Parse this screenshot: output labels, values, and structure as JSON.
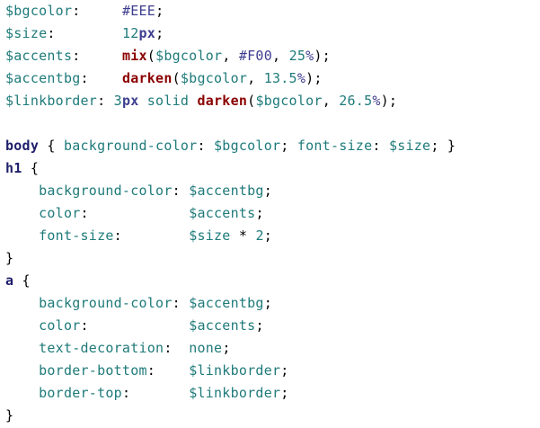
{
  "lines": [
    [
      {
        "t": "$bgcolor",
        "c": "var"
      },
      {
        "t": ":     ",
        "c": "punc"
      },
      {
        "t": "#EEE",
        "c": "hex"
      },
      {
        "t": ";",
        "c": "punc"
      }
    ],
    [
      {
        "t": "$size",
        "c": "var"
      },
      {
        "t": ":        ",
        "c": "punc"
      },
      {
        "t": "12",
        "c": "num"
      },
      {
        "t": "px",
        "c": "unit"
      },
      {
        "t": ";",
        "c": "punc"
      }
    ],
    [
      {
        "t": "$accents",
        "c": "var"
      },
      {
        "t": ":     ",
        "c": "punc"
      },
      {
        "t": "mix",
        "c": "fn"
      },
      {
        "t": "(",
        "c": "punc"
      },
      {
        "t": "$bgcolor",
        "c": "var"
      },
      {
        "t": ", ",
        "c": "punc"
      },
      {
        "t": "#F00",
        "c": "hex"
      },
      {
        "t": ", ",
        "c": "punc"
      },
      {
        "t": "25",
        "c": "num"
      },
      {
        "t": "%",
        "c": "pct"
      },
      {
        "t": ");",
        "c": "punc"
      }
    ],
    [
      {
        "t": "$accentbg",
        "c": "var"
      },
      {
        "t": ":    ",
        "c": "punc"
      },
      {
        "t": "darken",
        "c": "fn"
      },
      {
        "t": "(",
        "c": "punc"
      },
      {
        "t": "$bgcolor",
        "c": "var"
      },
      {
        "t": ", ",
        "c": "punc"
      },
      {
        "t": "13.5",
        "c": "num"
      },
      {
        "t": "%",
        "c": "pct"
      },
      {
        "t": ");",
        "c": "punc"
      }
    ],
    [
      {
        "t": "$linkborder",
        "c": "var"
      },
      {
        "t": ": ",
        "c": "punc"
      },
      {
        "t": "3",
        "c": "num"
      },
      {
        "t": "px",
        "c": "unit"
      },
      {
        "t": " solid ",
        "c": "kw"
      },
      {
        "t": "darken",
        "c": "fn"
      },
      {
        "t": "(",
        "c": "punc"
      },
      {
        "t": "$bgcolor",
        "c": "var"
      },
      {
        "t": ", ",
        "c": "punc"
      },
      {
        "t": "26.5",
        "c": "num"
      },
      {
        "t": "%",
        "c": "pct"
      },
      {
        "t": ");",
        "c": "punc"
      }
    ],
    [],
    [
      {
        "t": "body",
        "c": "sel"
      },
      {
        "t": " { ",
        "c": "punc"
      },
      {
        "t": "background-color",
        "c": "prop"
      },
      {
        "t": ": ",
        "c": "punc"
      },
      {
        "t": "$bgcolor",
        "c": "var"
      },
      {
        "t": "; ",
        "c": "punc"
      },
      {
        "t": "font-size",
        "c": "prop"
      },
      {
        "t": ": ",
        "c": "punc"
      },
      {
        "t": "$size",
        "c": "var"
      },
      {
        "t": "; }",
        "c": "punc"
      }
    ],
    [
      {
        "t": "h1",
        "c": "sel"
      },
      {
        "t": " {",
        "c": "punc"
      }
    ],
    [
      {
        "t": "    ",
        "c": "ws"
      },
      {
        "t": "background-color",
        "c": "prop"
      },
      {
        "t": ": ",
        "c": "punc"
      },
      {
        "t": "$accentbg",
        "c": "var"
      },
      {
        "t": ";",
        "c": "punc"
      }
    ],
    [
      {
        "t": "    ",
        "c": "ws"
      },
      {
        "t": "color",
        "c": "prop"
      },
      {
        "t": ":            ",
        "c": "punc"
      },
      {
        "t": "$accents",
        "c": "var"
      },
      {
        "t": ";",
        "c": "punc"
      }
    ],
    [
      {
        "t": "    ",
        "c": "ws"
      },
      {
        "t": "font-size",
        "c": "prop"
      },
      {
        "t": ":        ",
        "c": "punc"
      },
      {
        "t": "$size",
        "c": "var"
      },
      {
        "t": " * ",
        "c": "op"
      },
      {
        "t": "2",
        "c": "num"
      },
      {
        "t": ";",
        "c": "punc"
      }
    ],
    [
      {
        "t": "}",
        "c": "punc"
      }
    ],
    [
      {
        "t": "a",
        "c": "sel"
      },
      {
        "t": " {",
        "c": "punc"
      }
    ],
    [
      {
        "t": "    ",
        "c": "ws"
      },
      {
        "t": "background-color",
        "c": "prop"
      },
      {
        "t": ": ",
        "c": "punc"
      },
      {
        "t": "$accentbg",
        "c": "var"
      },
      {
        "t": ";",
        "c": "punc"
      }
    ],
    [
      {
        "t": "    ",
        "c": "ws"
      },
      {
        "t": "color",
        "c": "prop"
      },
      {
        "t": ":            ",
        "c": "punc"
      },
      {
        "t": "$accents",
        "c": "var"
      },
      {
        "t": ";",
        "c": "punc"
      }
    ],
    [
      {
        "t": "    ",
        "c": "ws"
      },
      {
        "t": "text-decoration",
        "c": "prop"
      },
      {
        "t": ":  ",
        "c": "punc"
      },
      {
        "t": "none",
        "c": "kw"
      },
      {
        "t": ";",
        "c": "punc"
      }
    ],
    [
      {
        "t": "    ",
        "c": "ws"
      },
      {
        "t": "border-bottom",
        "c": "prop"
      },
      {
        "t": ":    ",
        "c": "punc"
      },
      {
        "t": "$linkborder",
        "c": "var"
      },
      {
        "t": ";",
        "c": "punc"
      }
    ],
    [
      {
        "t": "    ",
        "c": "ws"
      },
      {
        "t": "border-top",
        "c": "prop"
      },
      {
        "t": ":       ",
        "c": "punc"
      },
      {
        "t": "$linkborder",
        "c": "var"
      },
      {
        "t": ";",
        "c": "punc"
      }
    ],
    [
      {
        "t": "}",
        "c": "punc"
      }
    ]
  ],
  "colors": {
    "background": "#ffffff",
    "variable": "#1f7a7a",
    "function": "#8b0000",
    "unit": "#3d3d8f",
    "selector": "#1e1e6b",
    "punctuation": "#000000"
  }
}
